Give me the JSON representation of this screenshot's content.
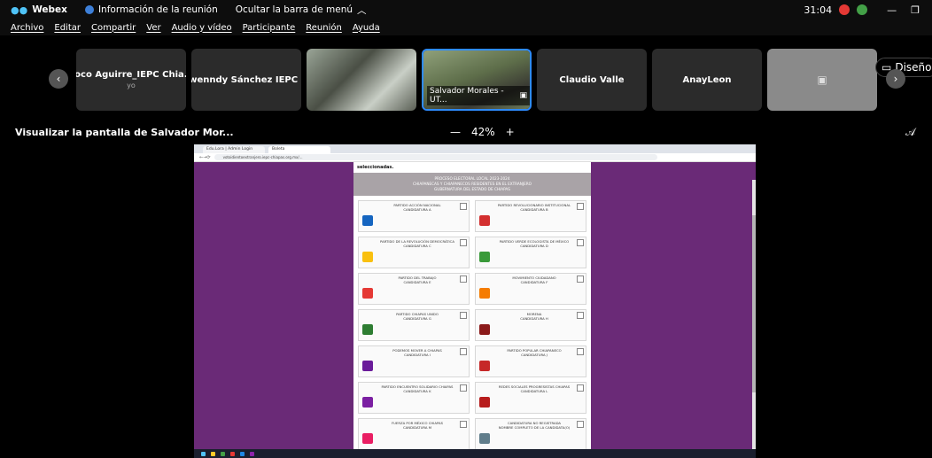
{
  "title_bar": {
    "app_name": "Webex",
    "meeting_info": "Información de la reunión",
    "hide_menu": "Ocultar la barra de menú",
    "timer": "31:04"
  },
  "menu": [
    "Archivo",
    "Editar",
    "Compartir",
    "Ver",
    "Audio y vídeo",
    "Participante",
    "Reunión",
    "Ayuda"
  ],
  "participants": [
    {
      "name": "Coco Aguirre_IEPC Chia...",
      "sub": "yo"
    },
    {
      "name": "Gwenndy Sánchez IEPC ..."
    },
    {
      "name": ""
    },
    {
      "name": "Salvador Morales - UT..."
    },
    {
      "name": "Claudio Valle"
    },
    {
      "name": "AnayLeon"
    },
    {
      "name": ""
    }
  ],
  "layout_button": "Diseño",
  "share_title": "Visualizar la pantalla de Salvador Mor...",
  "zoom": {
    "minus": "—",
    "value": "42%",
    "plus": "+"
  },
  "browser": {
    "tab1": "Edu.Lora | Admin Login",
    "tab2": "Boleta",
    "url": "votoidientoextranjero.iepc-chiapas.org.mx/..."
  },
  "ballot": {
    "intro": "seleccionadas.",
    "header_l1": "PROCESO ELECTORAL LOCAL 2023-2024",
    "header_l2": "CHIAPANECAS Y CHIAPANECOS RESIDENTES EN EL EXTRANJERO",
    "header_l3": "GUBERNATURA DEL ESTADO DE CHIAPAS",
    "parties": [
      {
        "name": "PARTIDO ACCIÓN NACIONAL",
        "cand": "CANDIDATURA A",
        "color": "#1565c0"
      },
      {
        "name": "PARTIDO REVOLUCIONARIO INSTITUCIONAL",
        "cand": "CANDIDATURA B",
        "color": "#d32f2f"
      },
      {
        "name": "PARTIDO DE LA REVOLUCIÓN DEMOCRÁTICA",
        "cand": "CANDIDATURA C",
        "color": "#f9c00f"
      },
      {
        "name": "PARTIDO VERDE ECOLOGISTA DE MÉXICO",
        "cand": "CANDIDATURA D",
        "color": "#3a9a3a"
      },
      {
        "name": "PARTIDO DEL TRABAJO",
        "cand": "CANDIDATURA E",
        "color": "#e53935"
      },
      {
        "name": "MOVIMIENTO CIUDADANO",
        "cand": "CANDIDATURA F",
        "color": "#f57c00"
      },
      {
        "name": "PARTIDO CHIAPAS UNIDO",
        "cand": "CANDIDATURA G",
        "color": "#2e7d32"
      },
      {
        "name": "MORENA",
        "cand": "CANDIDATURA H",
        "color": "#8b1a1a"
      },
      {
        "name": "PODEMOS MOVER A CHIAPAS",
        "cand": "CANDIDATURA I",
        "color": "#6a1b9a"
      },
      {
        "name": "PARTIDO POPULAR CHIAPANECO",
        "cand": "CANDIDATURA J",
        "color": "#c62828"
      },
      {
        "name": "PARTIDO ENCUENTRO SOLIDARIO CHIAPAS",
        "cand": "CANDIDATURA K",
        "color": "#7b1fa2"
      },
      {
        "name": "REDES SOCIALES PROGRESISTAS CHIAPAS",
        "cand": "CANDIDATURA L",
        "color": "#b71c1c"
      },
      {
        "name": "FUERZA POR MÉXICO CHIAPAS",
        "cand": "CANDIDATURA M",
        "color": "#e91e63"
      },
      {
        "name": "CANDIDATURA NO REGISTRADA",
        "cand": "NOMBRE COMPLETO DE LA CANDIDATA(O)",
        "color": "#607d8b"
      }
    ]
  }
}
